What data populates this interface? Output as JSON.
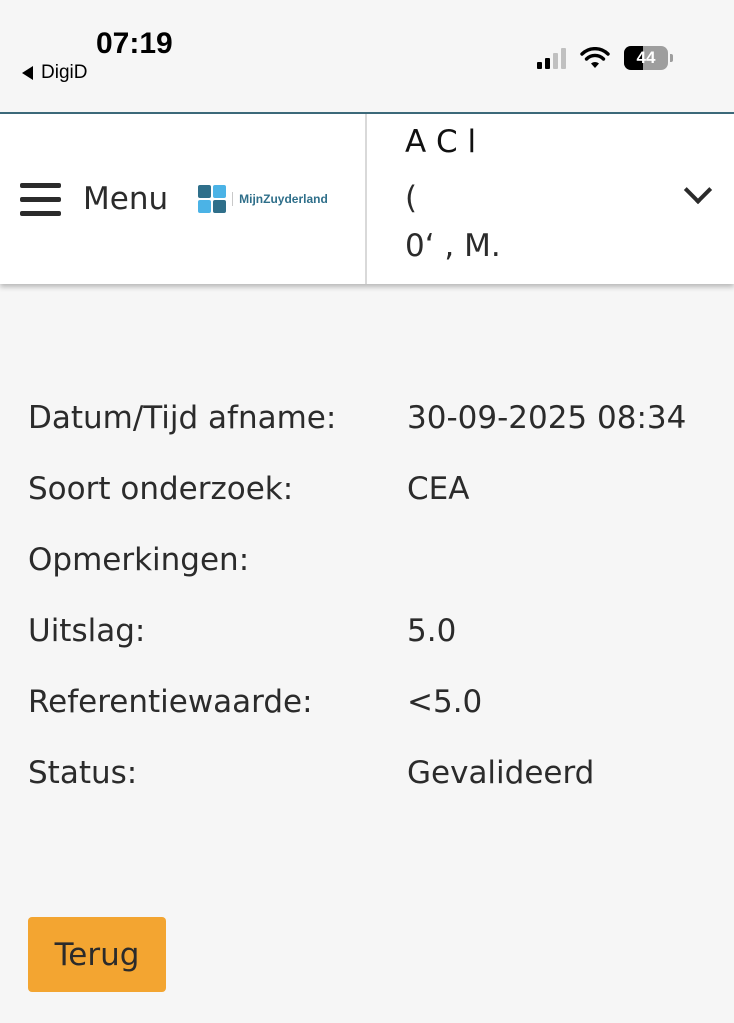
{
  "status_bar": {
    "time": "07:19",
    "back_app": "DigiD",
    "battery_level": "44",
    "battery_fraction": 0.44,
    "signal_bars_active": 2,
    "signal_bars_total": 4
  },
  "header": {
    "menu_label": "Menu",
    "logo_text": "MijnZuyderland",
    "logo_colors": [
      "#2f6f8a",
      "#4bb3e6",
      "#4bb3e6",
      "#2f6f8a"
    ],
    "patient_lines": [
      "A  C   l",
      "(",
      "0‘                ,      M."
    ]
  },
  "details": [
    {
      "label": "Datum/Tijd afname:",
      "value": "30-09-2025 08:34"
    },
    {
      "label": "Soort onderzoek:",
      "value": "CEA"
    },
    {
      "label": "Opmerkingen:",
      "value": ""
    },
    {
      "label": "Uitslag:",
      "value": "5.0"
    },
    {
      "label": "Referentiewaarde:",
      "value": "<5.0"
    },
    {
      "label": "Status:",
      "value": "Gevalideerd"
    }
  ],
  "back_button_label": "Terug",
  "colors": {
    "accent_button": "#f3a531",
    "header_rule": "#3d6b7c",
    "background": "#f6f6f6"
  }
}
